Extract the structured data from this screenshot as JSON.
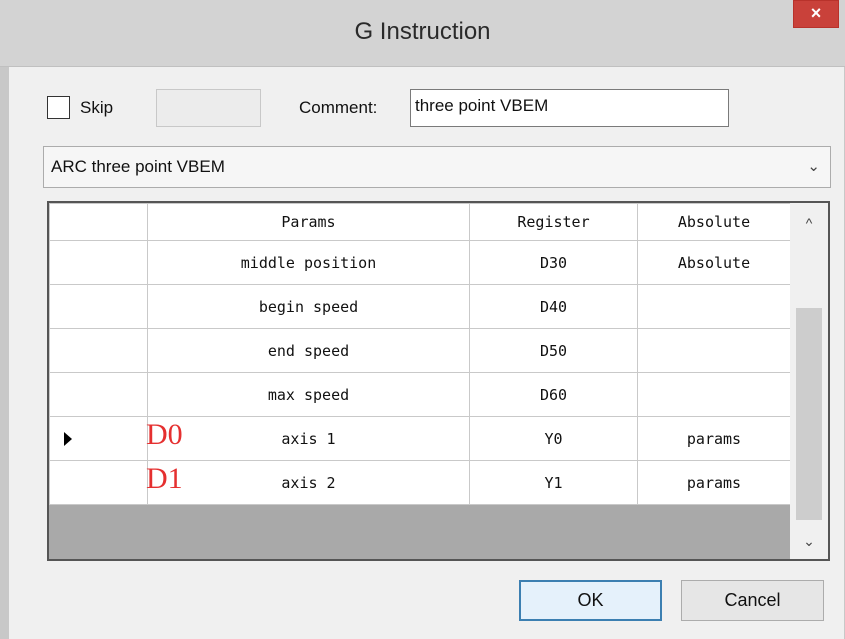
{
  "dialog": {
    "title": "G Instruction",
    "close_glyph": "×"
  },
  "skip": {
    "label": "Skip",
    "checked": false
  },
  "comment": {
    "label": "Comment:",
    "value": "three point VBEM"
  },
  "instruction_select": {
    "selected": "ARC three point VBEM",
    "arrow": "⌄"
  },
  "grid": {
    "headers": {
      "params": "Params",
      "register": "Register",
      "absolute": "Absolute"
    },
    "rows": [
      {
        "param": "middle position",
        "register": "D30",
        "absolute": "Absolute",
        "annotation": "",
        "current": false
      },
      {
        "param": "begin speed",
        "register": "D40",
        "absolute": "",
        "annotation": "",
        "current": false
      },
      {
        "param": "end speed",
        "register": "D50",
        "absolute": "",
        "annotation": "",
        "current": false
      },
      {
        "param": "max speed",
        "register": "D60",
        "absolute": "",
        "annotation": "",
        "current": false
      },
      {
        "param": "axis 1",
        "register": "Y0",
        "absolute": "params",
        "annotation": "D0",
        "current": true
      },
      {
        "param": "axis 2",
        "register": "Y1",
        "absolute": "params",
        "annotation": "D1",
        "current": false
      }
    ],
    "scroll_up": "^",
    "scroll_down": "⌄"
  },
  "buttons": {
    "ok": "OK",
    "cancel": "Cancel"
  }
}
